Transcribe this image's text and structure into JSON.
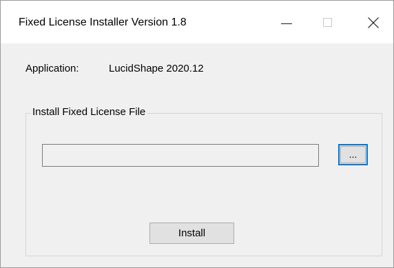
{
  "window": {
    "title": "Fixed License Installer Version 1.8"
  },
  "titlebar_buttons": {
    "minimize_icon": "minimize-icon",
    "maximize_icon": "maximize-icon",
    "close_icon": "close-icon"
  },
  "application": {
    "label": "Application:",
    "value": "LucidShape 2020.12"
  },
  "install_group": {
    "legend": "Install Fixed License File",
    "file_path_value": "",
    "browse_label": "...",
    "install_label": "Install"
  },
  "colors": {
    "focus_border": "#0078d7",
    "button_face": "#e1e1e1",
    "dialog_background": "#f0f0f0"
  }
}
